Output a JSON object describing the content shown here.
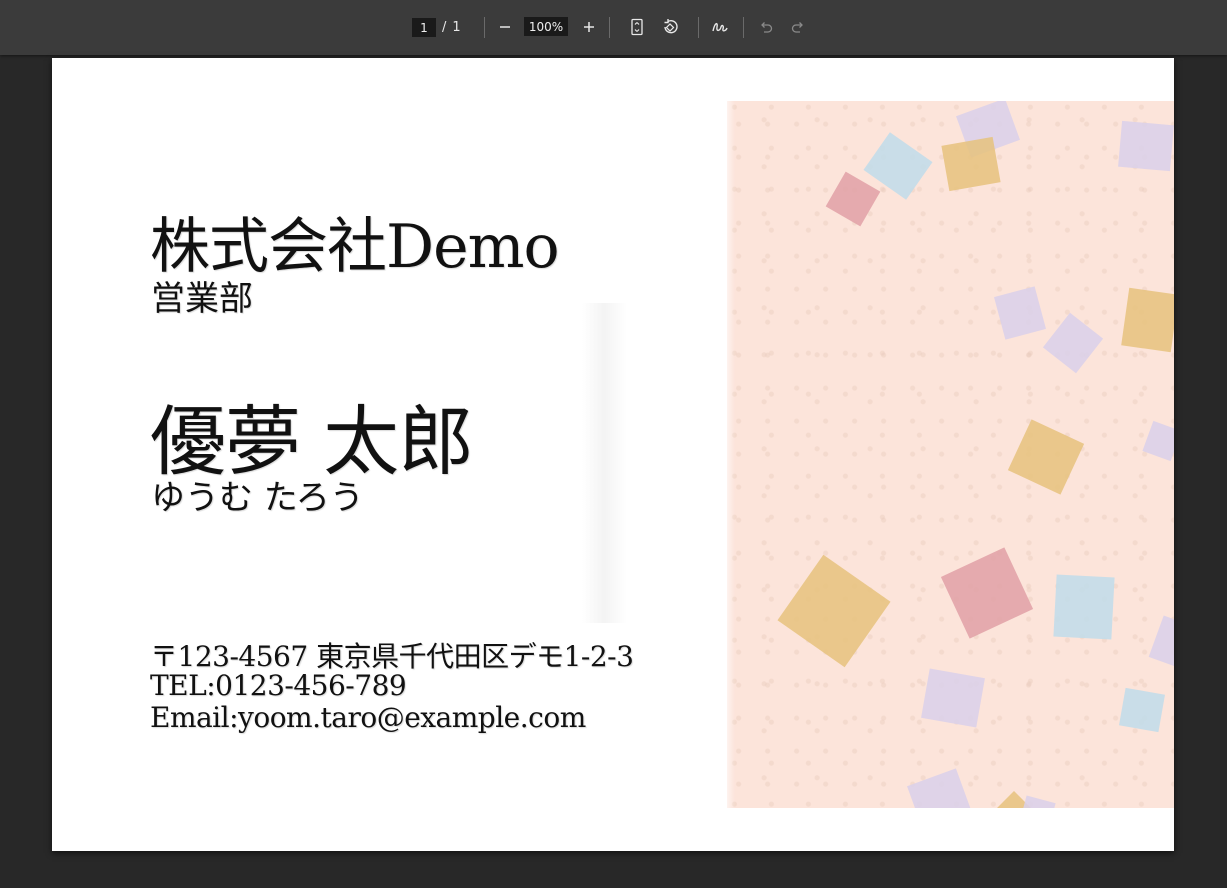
{
  "toolbar": {
    "page_current": "1",
    "page_separator": "/",
    "page_total": "1",
    "zoom": "100%",
    "buttons": [
      {
        "name": "zoom-out-button",
        "icon": "minus-icon"
      },
      {
        "name": "zoom-in-button",
        "icon": "plus-icon"
      },
      {
        "name": "fit-page-button",
        "icon": "fit-page-icon"
      },
      {
        "name": "rotate-button",
        "icon": "rotate-icon"
      },
      {
        "name": "draw-button",
        "icon": "draw-icon"
      },
      {
        "name": "undo-button",
        "icon": "undo-icon",
        "disabled": true
      },
      {
        "name": "redo-button",
        "icon": "redo-icon",
        "disabled": true
      }
    ]
  },
  "card": {
    "company": "株式会社Demo",
    "department": "営業部",
    "name": "優夢 太郎",
    "name_kana": "ゆうむ たろう",
    "address": "〒123-4567 東京県千代田区デモ1-2-3",
    "tel": "TEL:0123-456-789",
    "email": "Email:yoom.taro@example.com"
  },
  "colors": {
    "toolbar_bg": "#3b3b3b",
    "viewer_bg": "#282828",
    "paper": "#fce4da",
    "confetti_lavender": "#d9d0ea",
    "confetti_blue": "#bfdcea",
    "confetti_yellow": "#e6c27c",
    "confetti_red": "#e0a0a6"
  }
}
